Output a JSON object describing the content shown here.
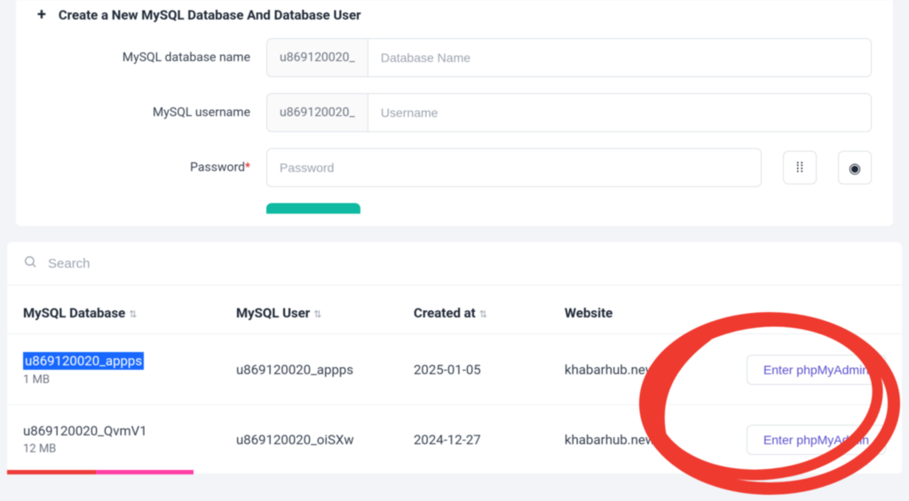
{
  "createForm": {
    "title": "Create a New MySQL Database And Database User",
    "dbNameLabel": "MySQL database name",
    "usernameLabel": "MySQL username",
    "passwordLabel": "Password",
    "prefix": "u869120020_",
    "dbNamePlaceholder": "Database Name",
    "usernamePlaceholder": "Username",
    "passwordPlaceholder": "Password"
  },
  "search": {
    "placeholder": "Search"
  },
  "table": {
    "headers": {
      "db": "MySQL Database",
      "user": "MySQL User",
      "created": "Created at",
      "site": "Website"
    },
    "rows": [
      {
        "db": "u869120020_appps",
        "size": "1 MB",
        "user": "u869120020_appps",
        "created": "2025-01-05",
        "site": "khabarhub.news",
        "action": "Enter phpMyAdmin",
        "selected": true
      },
      {
        "db": "u869120020_QvmV1",
        "size": "12 MB",
        "user": "u869120020_oiSXw",
        "created": "2024-12-27",
        "site": "khabarhub.news",
        "action": "Enter phpMyAdmin",
        "selected": false
      }
    ]
  },
  "annotation": {
    "color": "#ef3a2f"
  }
}
